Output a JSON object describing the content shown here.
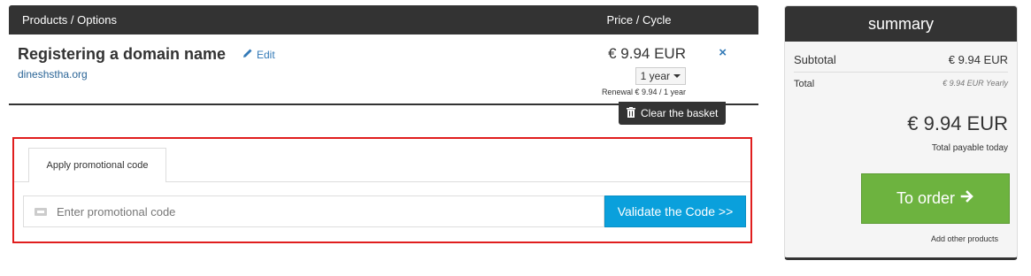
{
  "cart": {
    "header": {
      "products_label": "Products / Options",
      "price_label": "Price / Cycle"
    },
    "item": {
      "name": "Registering a domain name",
      "edit_label": "Edit",
      "domain": "dineshstha.org",
      "price": "€ 9.94 EUR",
      "cycle": "1 year",
      "renewal": "Renewal € 9.94 / 1 year",
      "remove_icon": "×"
    },
    "clear_label": "Clear the basket"
  },
  "promo": {
    "tab_label": "Apply promotional code",
    "input_placeholder": "Enter promotional code",
    "input_value": "",
    "validate_label": "Validate the Code >>",
    "highlight_color": "#e01e1e"
  },
  "summary": {
    "title": "summary",
    "subtotal_label": "Subtotal",
    "subtotal_value": "€ 9.94 EUR",
    "total_label": "Total",
    "total_value": "€ 9.94 EUR Yearly",
    "big_total": "€ 9.94 EUR",
    "payable_label": "Total payable today",
    "order_label": "To order",
    "add_other_label": "Add other products",
    "order_color": "#6db33f"
  },
  "colors": {
    "accent_blue": "#0aa0dc",
    "dark": "#333333",
    "link": "#337ab7"
  }
}
